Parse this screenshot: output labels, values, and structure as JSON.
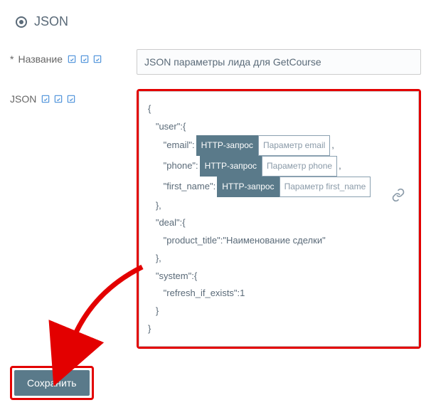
{
  "header": {
    "title": "JSON"
  },
  "fields": {
    "name_label": "Название",
    "name_value": "JSON параметры лида для GetCourse",
    "json_label": "JSON"
  },
  "json_body": {
    "l1": "{",
    "l2": "   \"user\":{",
    "l3_key": "      \"email\":",
    "l3_http": "HTTP-запрос",
    "l3_param": "Параметр email",
    "l3_tail": ",",
    "l4_key": "      \"phone\":",
    "l4_http": "HTTP-запрос",
    "l4_param": "Параметр phone",
    "l4_tail": ",",
    "l5_key": "      \"first_name\":",
    "l5_http": "HTTP-запрос",
    "l5_param": "Параметр first_name",
    "l6": "   },",
    "l7": "   \"deal\":{",
    "l8": "      \"product_title\":\"Наименование сделки\"",
    "l9": "   },",
    "l10": "   \"system\":{",
    "l11": "      \"refresh_if_exists\":1",
    "l12": "   }",
    "l13": "}"
  },
  "buttons": {
    "save": "Сохранить"
  }
}
